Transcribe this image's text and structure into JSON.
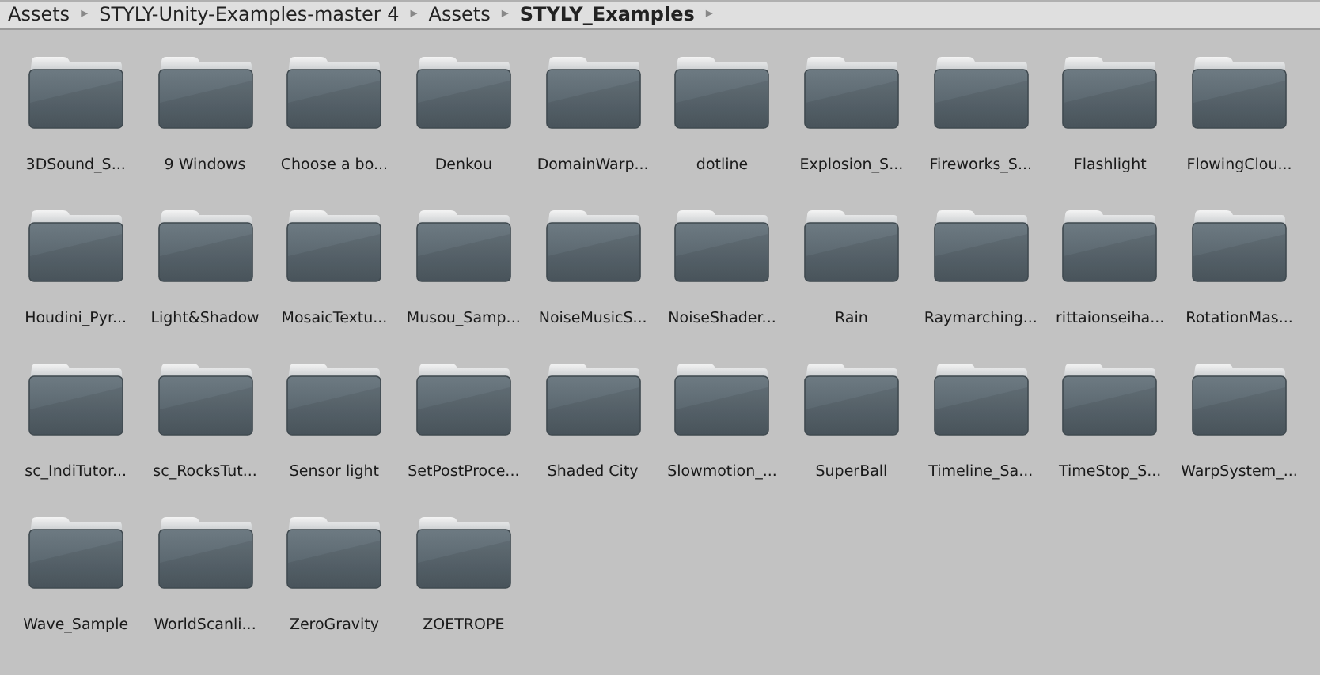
{
  "breadcrumb": [
    {
      "label": "Assets",
      "selected": false,
      "separator": "▸"
    },
    {
      "label": "STYLY-Unity-Examples-master 4",
      "selected": false,
      "separator": "▸"
    },
    {
      "label": "Assets",
      "selected": false,
      "separator": "▸"
    },
    {
      "label": "STYLY_Examples",
      "selected": true,
      "separator": "▸"
    }
  ],
  "folders": [
    {
      "label": "3DSound_S..."
    },
    {
      "label": "9 Windows"
    },
    {
      "label": "Choose a bo..."
    },
    {
      "label": "Denkou"
    },
    {
      "label": "DomainWarp..."
    },
    {
      "label": "dotline"
    },
    {
      "label": "Explosion_S..."
    },
    {
      "label": "Fireworks_S..."
    },
    {
      "label": "Flashlight"
    },
    {
      "label": "FlowingClou..."
    },
    {
      "label": "Houdini_Pyr..."
    },
    {
      "label": "Light&Shadow"
    },
    {
      "label": "MosaicTextu..."
    },
    {
      "label": "Musou_Samp..."
    },
    {
      "label": "NoiseMusicS..."
    },
    {
      "label": "NoiseShader..."
    },
    {
      "label": "Rain"
    },
    {
      "label": "Raymarching..."
    },
    {
      "label": "rittaionseiha..."
    },
    {
      "label": "RotationMas..."
    },
    {
      "label": "sc_IndiTutor..."
    },
    {
      "label": "sc_RocksTut..."
    },
    {
      "label": "Sensor light"
    },
    {
      "label": "SetPostProce..."
    },
    {
      "label": "Shaded City"
    },
    {
      "label": "Slowmotion_..."
    },
    {
      "label": "SuperBall"
    },
    {
      "label": "Timeline_Sa..."
    },
    {
      "label": "TimeStop_S..."
    },
    {
      "label": "WarpSystem_..."
    },
    {
      "label": "Wave_Sample"
    },
    {
      "label": "WorldScanli..."
    },
    {
      "label": "ZeroGravity"
    },
    {
      "label": "ZOETROPE"
    }
  ]
}
